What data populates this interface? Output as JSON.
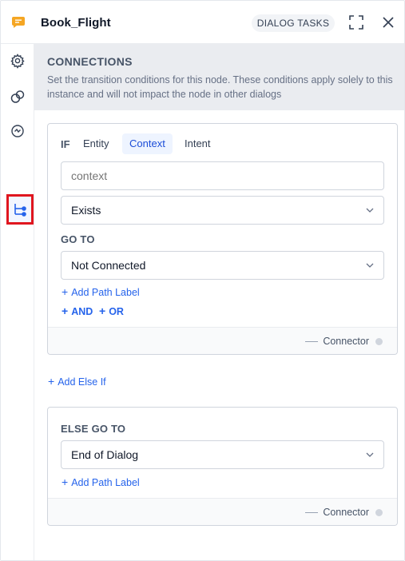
{
  "header": {
    "title": "Book_Flight",
    "badge": "DIALOG TASKS"
  },
  "colors": {
    "accent": "#2563eb",
    "highlight_box": "#e0161f",
    "app_icon": "#f5a623"
  },
  "rail": {
    "items": [
      "gear-icon",
      "link-icon",
      "history-icon",
      "connections-icon"
    ],
    "active": "connections-icon"
  },
  "section": {
    "title": "CONNECTIONS",
    "description": "Set the transition conditions for this node. These conditions apply solely to this instance and will not impact the node in other dialogs"
  },
  "if_card": {
    "if_label": "IF",
    "tabs": [
      {
        "label": "Entity",
        "active": false
      },
      {
        "label": "Context",
        "active": true
      },
      {
        "label": "Intent",
        "active": false
      }
    ],
    "context_input": {
      "value": "",
      "placeholder": "context"
    },
    "condition_select": "Exists",
    "go_to_label": "GO TO",
    "go_to_select": "Not Connected",
    "add_path_label": "Add Path Label",
    "and_label": "AND",
    "or_label": "OR",
    "connector": "Connector"
  },
  "add_else_if": "Add Else If",
  "else_card": {
    "label": "ELSE GO TO",
    "select": "End of Dialog",
    "add_path_label": "Add Path Label",
    "connector": "Connector"
  }
}
